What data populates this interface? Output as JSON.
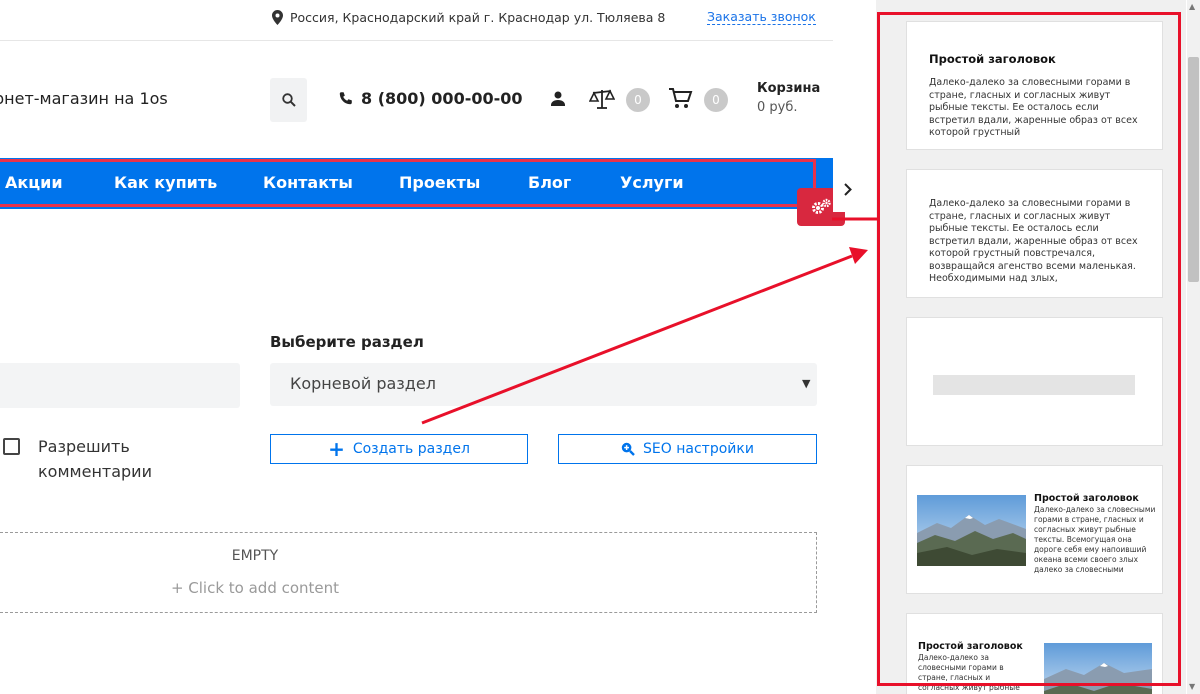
{
  "topbar": {
    "address": "Россия, Краснодарский край г. Краснодар ул. Тюляева 8",
    "callback_link": "Заказать звонок"
  },
  "header": {
    "shop_name": "рнет-магазин на 1os",
    "phone": "8 (800) 000-00-00",
    "compare_count": "0",
    "cart_count": "0",
    "cart_title": "Корзина",
    "cart_sum": "0 руб."
  },
  "nav": {
    "items": [
      "Акции",
      "Как купить",
      "Контакты",
      "Проекты",
      "Блог",
      "Услуги"
    ]
  },
  "form": {
    "section_label": "Выберите раздел",
    "section_value": "Корневой раздел",
    "comments_label": "Разрешить комментарии",
    "create_button": "Создать раздел",
    "seo_button": "SEO настройки"
  },
  "content": {
    "empty_title": "EMPTY",
    "empty_add": "+ Click to add content"
  },
  "panel": {
    "cards": [
      {
        "title": "Простой заголовок",
        "text": "Далеко-далеко за словесными горами в стране, гласных и согласных живут рыбные тексты. Ее осталось если встретил вдали, жаренные образ от всех которой грустный"
      },
      {
        "text": "Далеко-далеко за словесными горами в стране, гласных и согласных живут рыбные тексты. Ее осталось если встретил вдали, жаренные образ от всех которой грустный повстречался, возвращайся агенство всеми маленькая. Необходимыми над злых,"
      },
      {
        "title": "Простой заголовок",
        "text": "Далеко-далеко за словесными горами в стране, гласных и согласных живут рыбные тексты. Всемогущая она дороге себя ему напоивший океана всеми своего злых далеко за словесными"
      },
      {
        "title": "Простой заголовок",
        "text": "Далеко-далеко за словесными горами в стране, гласных и согласных живут рыбные тексты."
      }
    ]
  },
  "colors": {
    "brand_blue": "#0074ec",
    "accent_red": "#e8102a",
    "gear_red": "#d8283f"
  }
}
